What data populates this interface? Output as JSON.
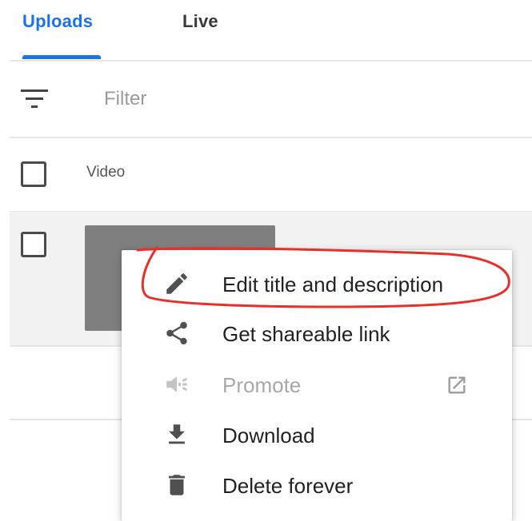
{
  "tabs": [
    {
      "label": "Uploads",
      "active": true
    },
    {
      "label": "Live",
      "active": false
    }
  ],
  "filter": {
    "placeholder": "Filter",
    "value": ""
  },
  "table": {
    "column_header": "Video"
  },
  "context_menu": {
    "items": [
      {
        "label": "Edit title and description",
        "icon": "pencil-icon",
        "disabled": false,
        "highlighted": true
      },
      {
        "label": "Get shareable link",
        "icon": "share-icon",
        "disabled": false
      },
      {
        "label": "Promote",
        "icon": "megaphone-icon",
        "disabled": true,
        "trailing_icon": "open-in-new-icon"
      },
      {
        "label": "Download",
        "icon": "download-icon",
        "disabled": false
      },
      {
        "label": "Delete forever",
        "icon": "trash-icon",
        "disabled": false
      }
    ]
  },
  "colors": {
    "accent": "#1a73e8",
    "annotation": "#e8302a",
    "thumbnail": "#7f7f7f",
    "row_background": "#f2f2f2"
  }
}
